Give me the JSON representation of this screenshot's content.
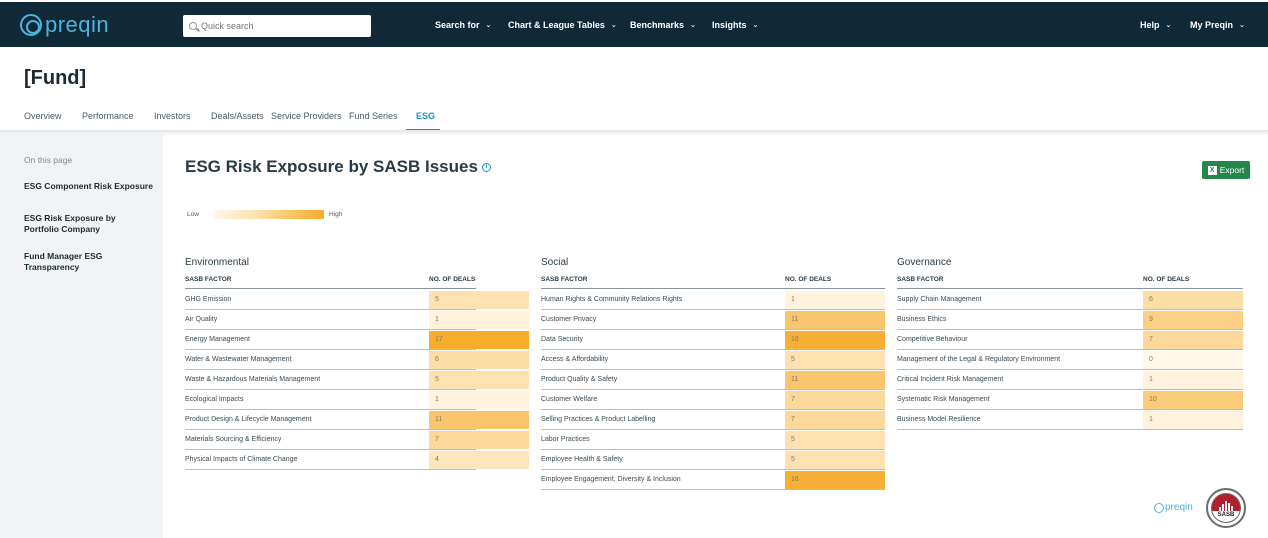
{
  "brand": {
    "logo_text": "preqin"
  },
  "search": {
    "placeholder": "Quick search"
  },
  "nav": {
    "items": [
      {
        "label": "Search for"
      },
      {
        "label": "Chart & League Tables"
      },
      {
        "label": "Benchmarks"
      },
      {
        "label": "Insights"
      }
    ],
    "right": [
      {
        "label": "Help"
      },
      {
        "label": "My Preqin"
      }
    ]
  },
  "page": {
    "title": "[Fund]"
  },
  "tabs": [
    {
      "label": "Overview"
    },
    {
      "label": "Performance"
    },
    {
      "label": "Investors"
    },
    {
      "label": "Deals/Assets"
    },
    {
      "label": "Service Providers"
    },
    {
      "label": "Fund Series"
    },
    {
      "label": "ESG",
      "active": true
    }
  ],
  "sidebar": {
    "heading": "On this page",
    "items": [
      {
        "label": "ESG Component Risk Exposure"
      },
      {
        "label": "ESG Risk Exposure by Portfolio Company"
      },
      {
        "label": "Fund Manager ESG Transparency"
      }
    ]
  },
  "section": {
    "title": "ESG Risk Exposure by SASB Issues",
    "info_icon": "info-icon",
    "export_label": "Export"
  },
  "legend": {
    "low": "Low",
    "high": "High"
  },
  "colors": {
    "header_bg": "#0f2a36",
    "accent": "#1b8fc9",
    "export_bg": "#23864a",
    "heat_low": "#fff7e9",
    "heat_high": "#f7ac2a"
  },
  "groups": [
    {
      "title": "Environmental",
      "factor_header": "SASB FACTOR",
      "deals_header": "NO. OF DEALS",
      "rows": [
        {
          "factor": "GHG Emission",
          "deals": "5"
        },
        {
          "factor": "Air Quality",
          "deals": "1"
        },
        {
          "factor": "Energy Management",
          "deals": "17"
        },
        {
          "factor": "Water & Wastewater Management",
          "deals": "6"
        },
        {
          "factor": "Waste & Hazardous Materials Management",
          "deals": "5"
        },
        {
          "factor": "Ecological Impacts",
          "deals": "1"
        },
        {
          "factor": "Product Design & Lifecycle Management",
          "deals": "11"
        },
        {
          "factor": "Materials Sourcing & Efficiency",
          "deals": "7"
        },
        {
          "factor": "Physical Impacts of Climate Change",
          "deals": "4"
        }
      ]
    },
    {
      "title": "Social",
      "factor_header": "SASB FACTOR",
      "deals_header": "NO. OF DEALS",
      "rows": [
        {
          "factor": "Human Rights & Community Relations Rights",
          "deals": "1"
        },
        {
          "factor": "Customer Privacy",
          "deals": "11"
        },
        {
          "factor": "Data Security",
          "deals": "16"
        },
        {
          "factor": "Access & Affordability",
          "deals": "5"
        },
        {
          "factor": "Product Quality & Safety",
          "deals": "11"
        },
        {
          "factor": "Customer Welfare",
          "deals": "7"
        },
        {
          "factor": "Selling Practices & Product Labelling",
          "deals": "7"
        },
        {
          "factor": "Labor Practices",
          "deals": "5"
        },
        {
          "factor": "Employee Health & Safety",
          "deals": "5"
        },
        {
          "factor": "Employee Engagement, Diversity & Inclusion",
          "deals": "16"
        }
      ]
    },
    {
      "title": "Governance",
      "factor_header": "SASB FACTOR",
      "deals_header": "NO. OF DEALS",
      "rows": [
        {
          "factor": "Supply Chain Management",
          "deals": "6"
        },
        {
          "factor": "Business Ethics",
          "deals": "9"
        },
        {
          "factor": "Competitive Behaviour",
          "deals": "7"
        },
        {
          "factor": "Management of the Legal & Regulatory Environment",
          "deals": "0"
        },
        {
          "factor": "Critical Incident Risk Management",
          "deals": "1"
        },
        {
          "factor": "Systematic Risk Management",
          "deals": "10"
        },
        {
          "factor": "Business Model Resilience",
          "deals": "1"
        }
      ]
    }
  ],
  "footer": {
    "logo_text": "preqin",
    "sasb_text": "SASB"
  }
}
